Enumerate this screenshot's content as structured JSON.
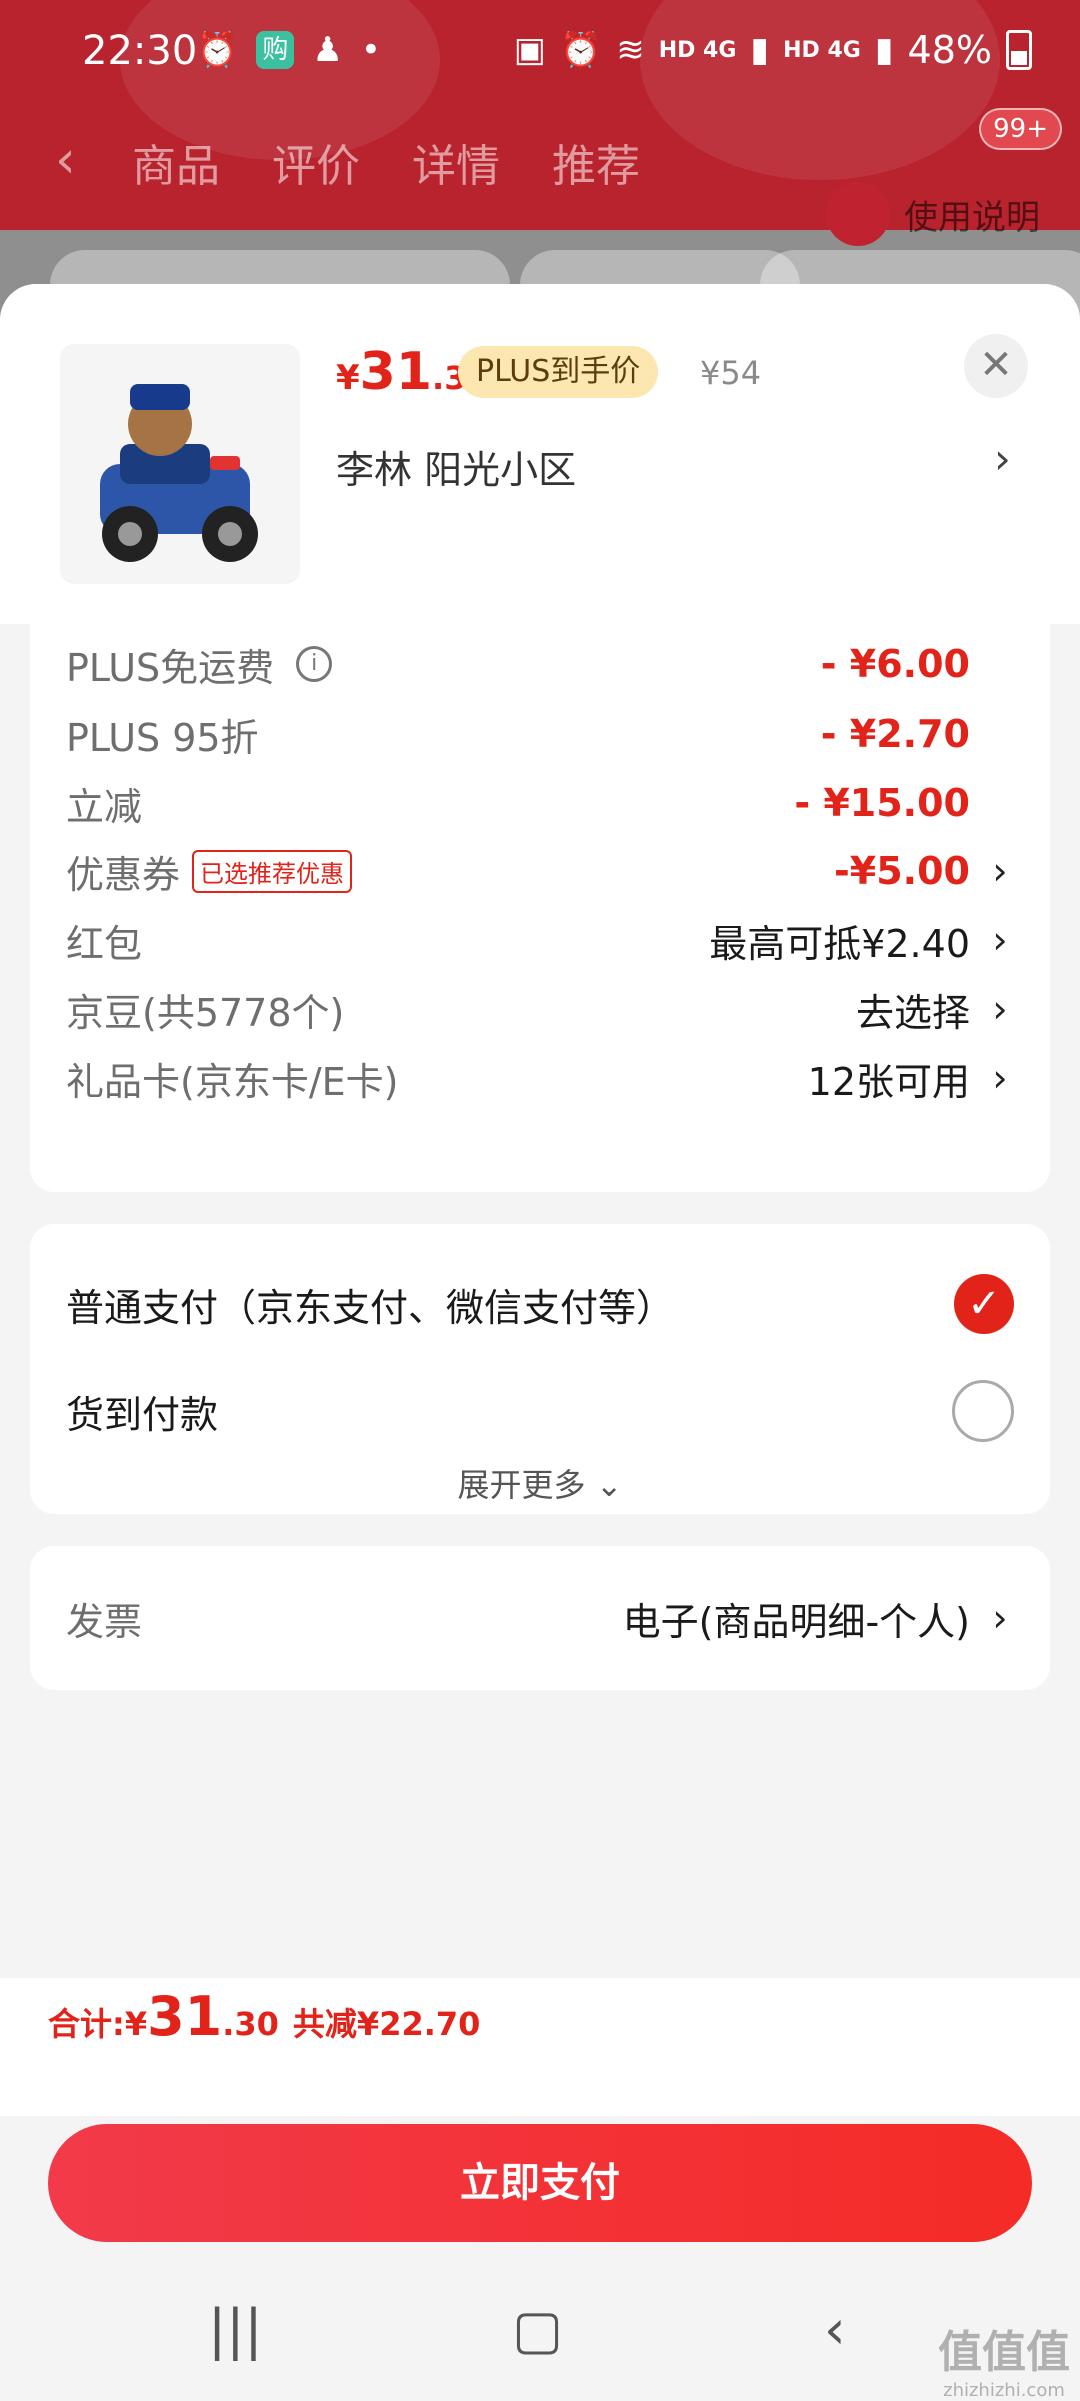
{
  "status_bar": {
    "time": "22:30",
    "battery": "48%",
    "net_label": "HD 4G"
  },
  "background_page": {
    "tabs": [
      "商品",
      "评价",
      "详情",
      "推荐"
    ],
    "badge": "99+",
    "manual_label": "使用说明"
  },
  "product": {
    "price_currency": "¥",
    "price_int": "31",
    "price_dec": ".3",
    "plus_badge": "PLUS到手价",
    "original_price": "¥54",
    "address": "李林  阳光小区"
  },
  "discounts": {
    "rows": [
      {
        "label": "PLUS免运费",
        "value": "- ¥6.00"
      },
      {
        "label": "PLUS 95折",
        "value": "- ¥2.70"
      },
      {
        "label": "立减",
        "value": "- ¥15.00"
      },
      {
        "label": "优惠券",
        "tag": "已选推荐优惠",
        "value": "-¥5.00"
      },
      {
        "label": "红包",
        "value": "最高可抵¥2.40"
      },
      {
        "label": "京豆(共5778个)",
        "value": "去选择"
      },
      {
        "label": "礼品卡(京东卡/E卡)",
        "value": "12张可用"
      }
    ]
  },
  "payment": {
    "options": [
      {
        "label": "普通支付（京东支付、微信支付等）",
        "selected": true
      },
      {
        "label": "货到付款",
        "selected": false
      }
    ],
    "expand_label": "展开更多"
  },
  "invoice": {
    "label": "发票",
    "value": "电子(商品明细-个人)"
  },
  "footer": {
    "total_label": "合计: ",
    "total_currency": "¥",
    "total_int": "31",
    "total_dec": ".30",
    "saved": "共减¥22.70",
    "pay_button": "立即支付"
  },
  "watermark": {
    "main": "值值值",
    "sub": "zhizhizhi.com"
  },
  "colors": {
    "accent": "#e2231a",
    "plus_badge_bg": "#fde7b0",
    "header_bg": "#b8232e"
  }
}
